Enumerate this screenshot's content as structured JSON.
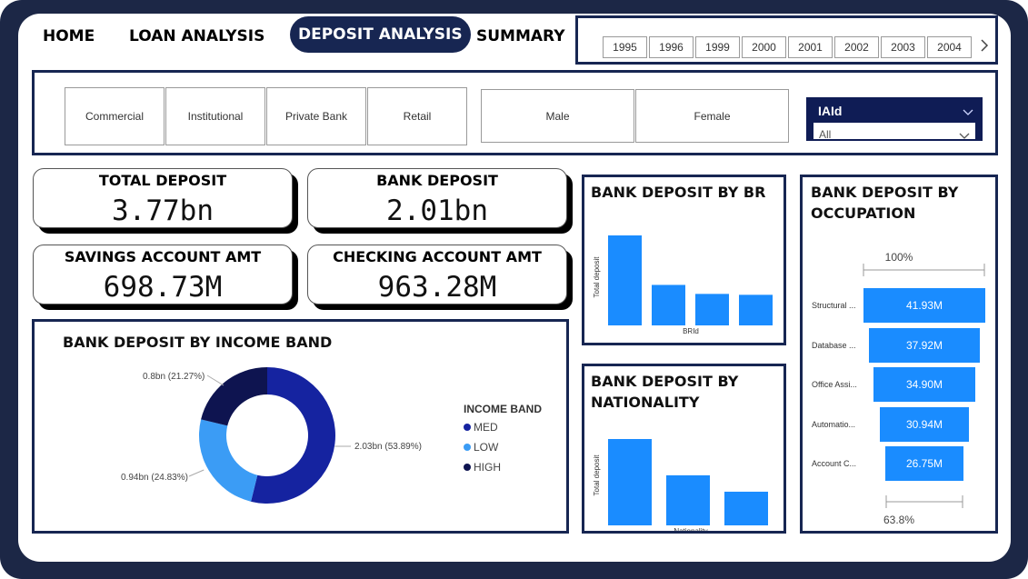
{
  "nav": {
    "home": "HOME",
    "loan": "LOAN ANALYSIS",
    "deposit": "DEPOSIT ANALYSIS",
    "summary": "SUMMARY"
  },
  "years": [
    "1995",
    "1996",
    "1999",
    "2000",
    "2001",
    "2002",
    "2003",
    "2004"
  ],
  "filters": {
    "bank_types": [
      "Commercial",
      "Institutional",
      "Private Bank",
      "Retail"
    ],
    "genders": [
      "Male",
      "Female"
    ],
    "dropdown": {
      "label": "IAId",
      "value": "All"
    }
  },
  "kpis": {
    "total_deposit": {
      "title": "TOTAL DEPOSIT",
      "value": "3.77bn"
    },
    "bank_deposit": {
      "title": "BANK DEPOSIT",
      "value": "2.01bn"
    },
    "savings": {
      "title": "SAVINGS ACCOUNT AMT",
      "value": "698.73M"
    },
    "checking": {
      "title": "CHECKING ACCOUNT AMT",
      "value": "963.28M"
    }
  },
  "colors": {
    "navy": "#172652",
    "frame": "#1c2746",
    "bar_blue": "#1a8cff",
    "donut_med": "#1523a0",
    "donut_low": "#3b9cf5",
    "donut_high": "#0e1450"
  },
  "chart_data": [
    {
      "type": "pie",
      "title": "BANK DEPOSIT BY INCOME BAND",
      "legend_title": "INCOME BAND",
      "legend_position": "right",
      "categories": [
        "MED",
        "LOW",
        "HIGH"
      ],
      "values": [
        2.03,
        0.94,
        0.8
      ],
      "percents": [
        53.89,
        24.83,
        21.27
      ],
      "labels": [
        "2.03bn (53.89%)",
        "0.94bn (24.83%)",
        "0.8bn (21.27%)"
      ]
    },
    {
      "type": "bar",
      "title": "BANK DEPOSIT BY BR",
      "xlabel": "BRId",
      "ylabel": "Total deposit",
      "categories": [
        "",
        "",
        "",
        ""
      ],
      "values": [
        1.0,
        0.45,
        0.35,
        0.34
      ],
      "grid": false
    },
    {
      "type": "bar",
      "title_lines": [
        "BANK DEPOSIT BY",
        "NATIONALITY"
      ],
      "xlabel": "Nationality",
      "ylabel": "Total deposit",
      "categories": [
        "",
        "",
        ""
      ],
      "values": [
        1.0,
        0.58,
        0.39
      ],
      "grid": false
    },
    {
      "type": "bar",
      "subtype": "funnel",
      "title_lines": [
        "BANK DEPOSIT BY",
        "OCCUPATION"
      ],
      "top_label": "100%",
      "bottom_label": "63.8%",
      "categories": [
        "Structural ...",
        "Database ...",
        "Office Assi...",
        "Automatio...",
        "Account C..."
      ],
      "values": [
        41.93,
        37.92,
        34.9,
        30.94,
        26.75
      ],
      "value_labels": [
        "41.93M",
        "37.92M",
        "34.90M",
        "30.94M",
        "26.75M"
      ]
    }
  ]
}
